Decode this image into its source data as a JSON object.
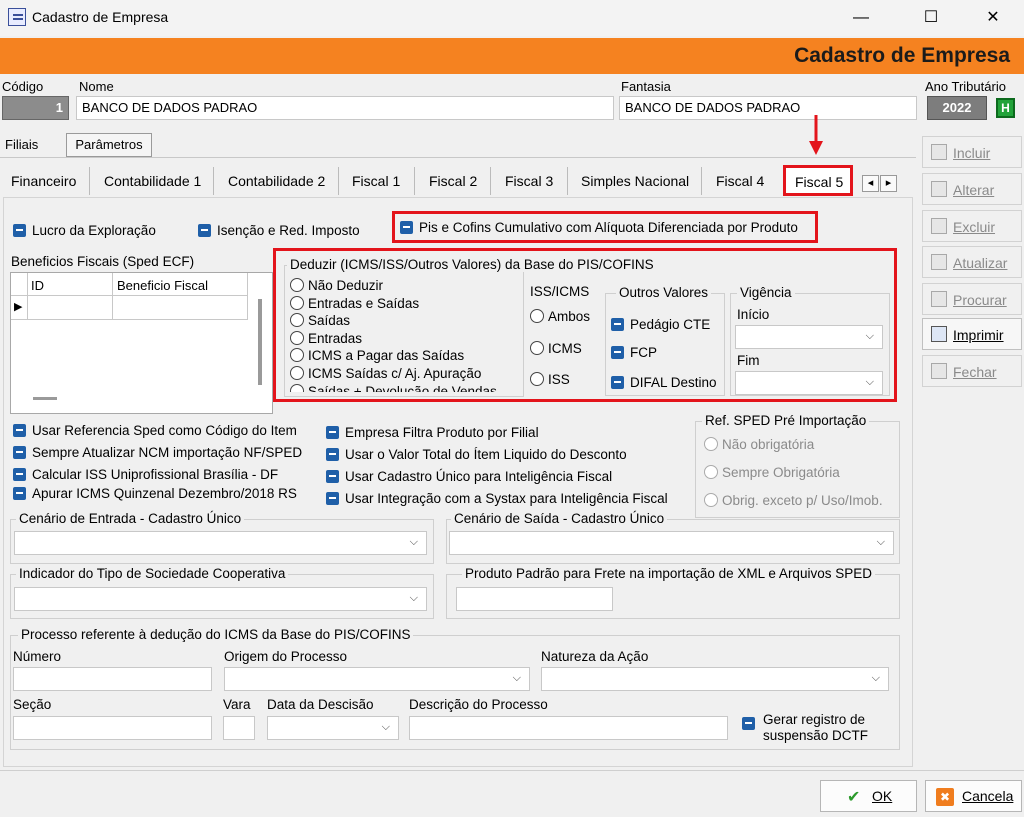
{
  "window": {
    "title": "Cadastro de Empresa",
    "minimize": "—",
    "maximize": "☐",
    "close": "✕"
  },
  "header": {
    "title": "Cadastro de Empresa"
  },
  "top_fields": {
    "codigo_label": "Código",
    "codigo_value": "1",
    "nome_label": "Nome",
    "nome_value": "BANCO DE DADOS PADRAO",
    "fantasia_label": "Fantasia",
    "fantasia_value": "BANCO DE DADOS PADRAO",
    "ano_label": "Ano Tributário",
    "ano_value": "2022",
    "ano_button": "H"
  },
  "outer_tabs": [
    "Filiais",
    "Parâmetros"
  ],
  "inner_tabs": [
    "Financeiro",
    "Contabilidade 1",
    "Contabilidade 2",
    "Fiscal 1",
    "Fiscal 2",
    "Fiscal 3",
    "Simples Nacional",
    "Fiscal 4",
    "Fiscal 5"
  ],
  "tab_nav": {
    "prev": "◂",
    "next": "▸"
  },
  "checks_top": {
    "lucro": "Lucro da Exploração",
    "isencao": "Isenção e Red. Imposto",
    "pis_cofins": "Pis e Cofins Cumulativo com Alíquota Diferenciada por Produto"
  },
  "beneficios": {
    "title": "Beneficios Fiscais (Sped ECF)",
    "col_id": "ID",
    "col_beneficio": "Beneficio Fiscal",
    "row_marker": "▶"
  },
  "deduzir": {
    "title": "Deduzir (ICMS/ISS/Outros Valores)  da Base do PIS/COFINS",
    "options": [
      "Não Deduzir",
      "Entradas e Saídas",
      "Saídas",
      "Entradas",
      "ICMS a Pagar das Saídas",
      "ICMS Saídas c/ Aj. Apuração",
      "Saídas + Devolução de Vendas"
    ],
    "iss_icms_title": "ISS/ICMS",
    "iss_icms_options": [
      "Ambos",
      "ICMS",
      "ISS"
    ],
    "outros_title": "Outros Valores",
    "outros_options": [
      "Pedágio CTE",
      "FCP",
      "DIFAL Destino"
    ],
    "vigencia_title": "Vigência",
    "inicio_label": "Início",
    "fim_label": "Fim"
  },
  "left_checks": [
    "Usar Referencia Sped como Código do Item",
    "Sempre Atualizar NCM importação NF/SPED",
    "Calcular ISS Uniprofissional Brasília - DF",
    "Apurar ICMS Quinzenal Dezembro/2018 RS"
  ],
  "mid_checks": [
    "Empresa Filtra Produto por Filial",
    "Usar o Valor Total do Ítem Liquido do Desconto",
    "Usar Cadastro Único para Inteligência Fiscal",
    "Usar Integração com a Systax para Inteligência Fiscal"
  ],
  "ref_sped": {
    "title": "Ref. SPED Pré Importação",
    "options": [
      "Não obrigatória",
      "Sempre Obrigatória",
      "Obrig. exceto p/ Uso/Imob."
    ]
  },
  "cenario": {
    "entrada": "Cenário de Entrada - Cadastro Único",
    "saida": "Cenário de Saída - Cadastro Único"
  },
  "cooperativa": {
    "indicador": "Indicador do Tipo de Sociedade Cooperativa",
    "produto_frete": "Produto Padrão para Frete na importação  de XML e Arquivos SPED"
  },
  "processo": {
    "title": "Processo referente à dedução do ICMS da Base do PIS/COFINS",
    "numero": "Número",
    "origem": "Origem do Processo",
    "natureza": "Natureza da Ação",
    "secao": "Seção",
    "vara": "Vara",
    "data": "Data da Descisão",
    "descricao": "Descrição do Processo",
    "gerar": "Gerar registro de",
    "gerar2": "suspensão DCTF"
  },
  "side_buttons": [
    "Incluir",
    "Alterar",
    "Excluir",
    "Atualizar",
    "Procurar",
    "Imprimir",
    "Fechar"
  ],
  "bottom_buttons": {
    "ok": "OK",
    "cancel": "Cancela",
    "ok_icon": "✔",
    "cancel_icon": "✖"
  },
  "chevron": "⌵",
  "colors": {
    "accent": "#f58220",
    "highlight": "#e3141b",
    "checkbox": "#1f5fa8"
  }
}
